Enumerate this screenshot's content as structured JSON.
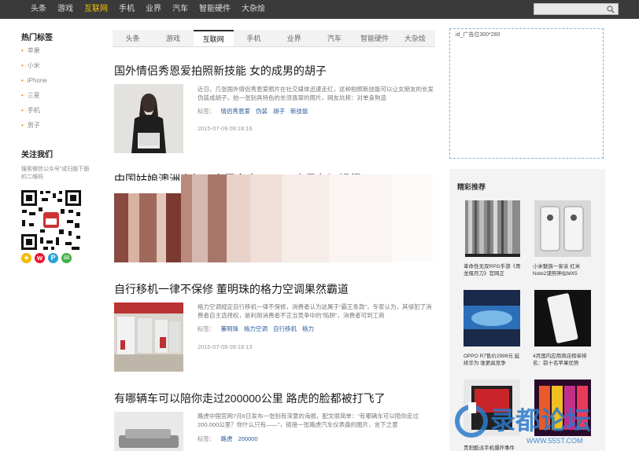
{
  "topnav": {
    "items": [
      "头条",
      "游戏",
      "互联网",
      "手机",
      "业界",
      "汽车",
      "智能硬件",
      "大杂烩"
    ],
    "active_index": 2
  },
  "search": {
    "placeholder": ""
  },
  "sidebar": {
    "hot_tags_title": "热门标签",
    "hot_tags": [
      "苹果",
      "小米",
      "iPhone",
      "三星",
      "手机",
      "男子"
    ],
    "follow_title": "关注我们",
    "follow_desc": "搜索微信公众号“成归版下面的二维码",
    "accent_color": "#f08a00"
  },
  "tabs": {
    "items": [
      "头条",
      "游戏",
      "互联网",
      "手机",
      "业界",
      "汽车",
      "智能硬件",
      "大杂烩"
    ],
    "active_index": 2
  },
  "articles": [
    {
      "title": "国外情侣秀恩爱拍照新技能 女的成男的胡子",
      "summary": "近日，几张国外情侣秀恩爱照片在社交媒体迅速走红，这种拍照新技能可以让女朋友的长发伪装成胡子，拍一张别具特色的长须翡翠的照片，网友坑称：对单身狗造",
      "tags_label": "标签：",
      "tags": [
        "情侣秀恩爱",
        "伪装",
        "胡子",
        "新技能"
      ],
      "date": "2015-07-09 09:18:16"
    },
    {
      "title": "中国姑娘澳洲走红：卡里多出92万元 立马归还银行"
    },
    {
      "title": "自行移机一律不保修 董明珠的格力空调果然霸道",
      "summary": "格力空调规定自行移机一律不保修，消费者认为这属于“霸王条款”，专家认为，其侵犯了消费者自主选择权，是利用消费者不正当竞争中的“陷阱”，消费者可到工商",
      "tags_label": "标签：",
      "tags": [
        "董明珠",
        "格力空调",
        "自行移机",
        "格力"
      ],
      "date": "2015-07-09 09:18:13"
    },
    {
      "title": "有哪辆车可以陪你走过200000公里 路虎的脸都被打飞了",
      "summary": "路虎中国官网7月6日发布一张别有深意的海报，配文很简单：“有哪辆车可以陪你走过200,000公里？你什么只有——”，链接一张路虎汽车仪表盘的图片，言下之意",
      "tags_label": "标签：",
      "tags": [
        "路虎",
        "200000"
      ]
    }
  ],
  "ad": {
    "label": "id_广告位300*280"
  },
  "recommend": {
    "title": "精彩推荐",
    "items": [
      {
        "caption": "革命性无双RPG手游《青龙偃月刀》官网正"
      },
      {
        "caption": "小米魅族一家亲 红米Note2谍照神似MX5"
      },
      {
        "caption": "OPPO R7售价2999元 延续华为 谁更具竞争"
      },
      {
        "caption": "4月国内应用商店榜单排名：前十名苹果优势"
      },
      {
        "caption": "贵阳酷派手机爆炸事件"
      },
      {
        "caption": ""
      }
    ]
  },
  "watermark": {
    "text": "录都论坛",
    "url": "WWW.55ST.COM"
  }
}
